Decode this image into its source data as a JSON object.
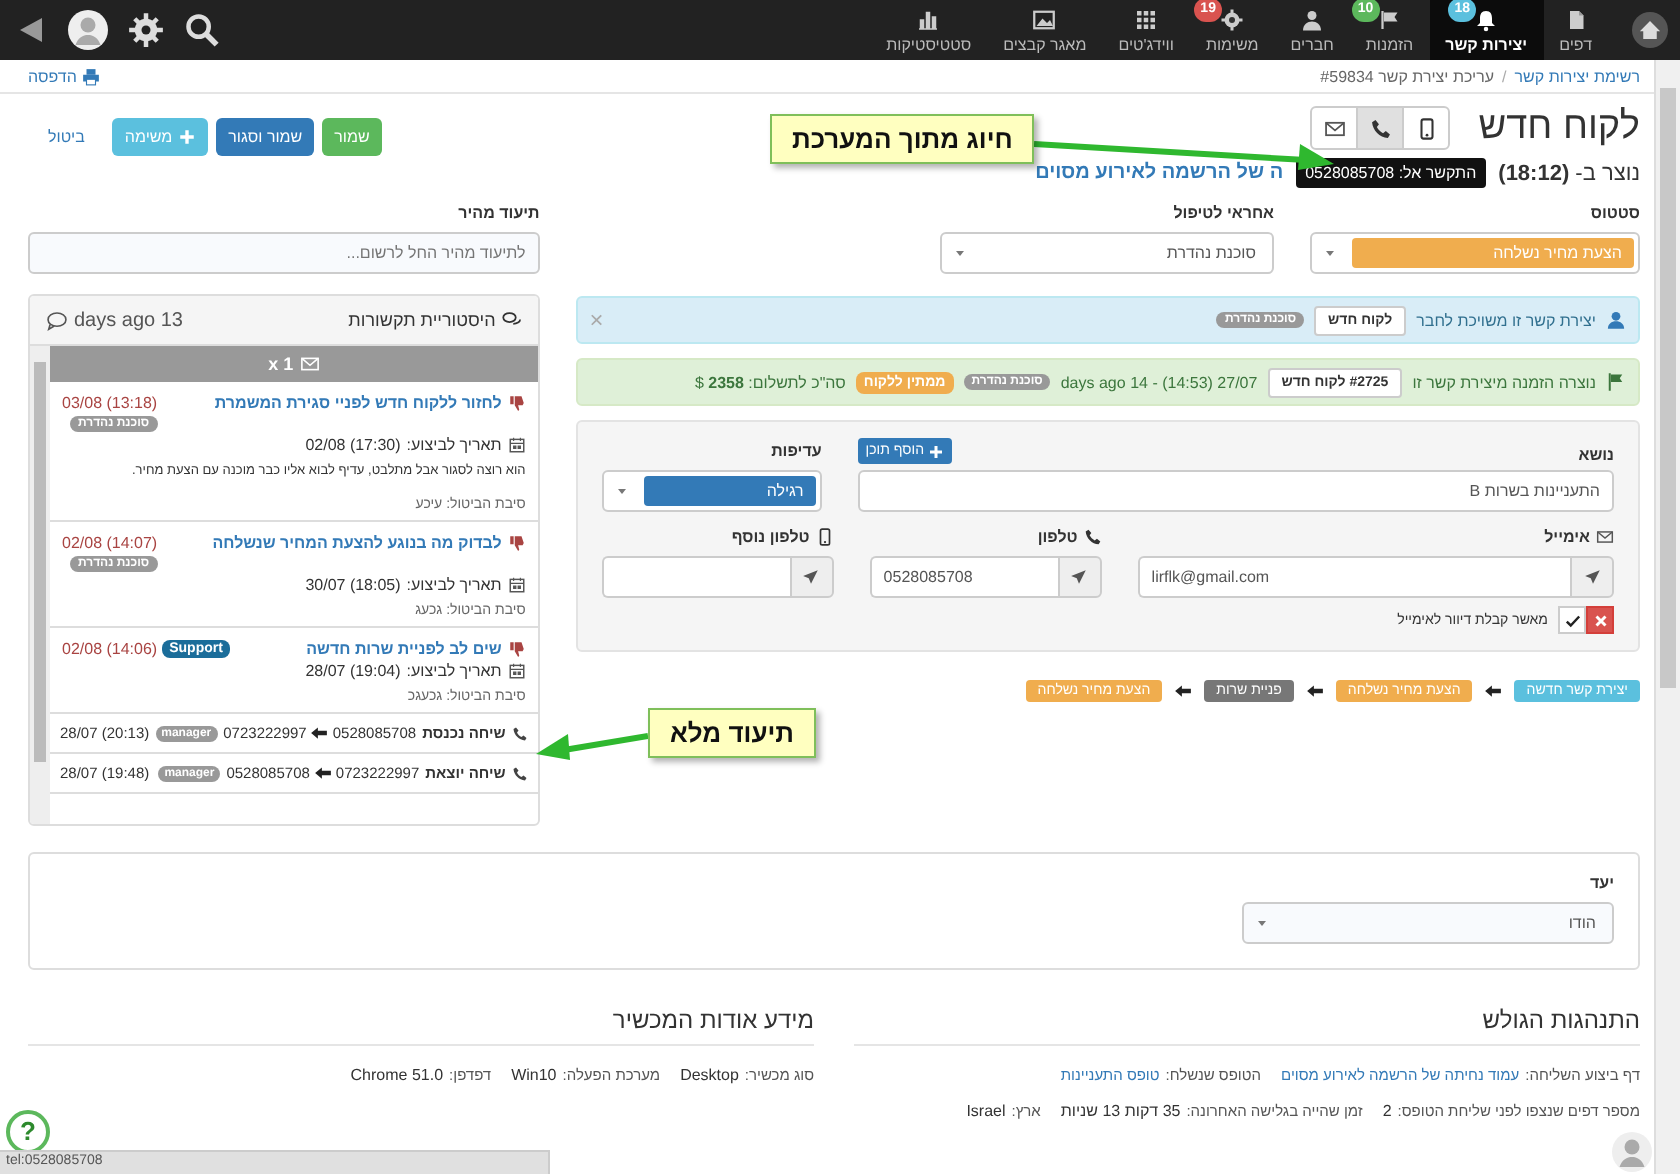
{
  "nav": {
    "items": [
      {
        "label": "דפים",
        "selected": false
      },
      {
        "label": "יצירות קשר",
        "badge": "18",
        "kind": "info",
        "selected": true
      },
      {
        "label": "הזמנות",
        "badge": "10",
        "kind": "success",
        "selected": false
      },
      {
        "label": "חברים",
        "selected": false
      },
      {
        "label": "משימות",
        "badge": "19",
        "kind": "danger",
        "selected": false
      },
      {
        "label": "ווידג'טים",
        "selected": false
      },
      {
        "label": "מאגר קבצים",
        "selected": false
      },
      {
        "label": "סטטיסטיקות",
        "selected": false
      }
    ]
  },
  "breadcrumb": {
    "items": [
      "רשימת יצירות קשר",
      "עריכת יצירת קשר #59834"
    ],
    "separator": "/",
    "print": "הדפסה"
  },
  "header": {
    "title": "לקוח חדש",
    "contact_buttons": [
      {
        "selected": false
      },
      {
        "selected": true
      },
      {
        "selected": false
      }
    ],
    "actions": [
      {
        "label": "שמור",
        "kind": "success"
      },
      {
        "label": "שמור וסגור",
        "kind": "primary"
      },
      {
        "label": "משימה",
        "kind": "info"
      },
      {
        "label": "ביטול",
        "kind": "link"
      }
    ],
    "created": "נוצר ב- **(18:12)**",
    "source_link": "ה של הרשמה לאירוע מסוים",
    "tooltip": "התקשר אל: 0528085708"
  },
  "fields": {
    "status": {
      "label": "סטטוס",
      "value": "הצעת מחיר נשלחה",
      "kind": "warning"
    },
    "handler": {
      "label": "אחראי לטיפול",
      "value": "סוכנת נהדרת"
    },
    "quick_note": {
      "label": "תיעוד מהיר",
      "placeholder": "לתיעוד מהיר החל לרשום..."
    }
  },
  "member_alert": {
    "text": "יצירת קשר זו משויכת לחבר",
    "button": "לקוח חדש",
    "tag": "סוכנת נהדרת",
    "close": "×"
  },
  "order_alert": {
    "text": "נוצרה הזמנה מיצירת קשר זו",
    "button": "#2725 לקוח חדש",
    "date": "27/07 (14:53) - 14 days ago",
    "tag": "סוכנת נהדרת",
    "status": "ממתין ללקוח",
    "total": "סה\"כ לתשלום: **2358** $"
  },
  "form": {
    "subject": {
      "label": "נושא",
      "add_button": "הוסף תוכן",
      "value": "התעניינות בשרות B"
    },
    "priority": {
      "label": "עדיפות",
      "value": "רגילה",
      "kind": "primary"
    },
    "email": {
      "label": "אימייל",
      "value": "lirflk@gmail.com"
    },
    "phone": {
      "label": "טלפון",
      "value": "0528085708"
    },
    "extra_phone": {
      "label": "טלפון נוסף"
    },
    "newsletter": {
      "label": "מאשר קבלת דיוור לאימייל",
      "approved": false
    }
  },
  "pipeline": [
    {
      "label": "יצירת קשר חדשה",
      "kind": "info"
    },
    {
      "label": "הצעת מחיר נשלחה",
      "kind": "warning"
    },
    {
      "label": "פניית שרות",
      "kind": "default"
    },
    {
      "label": "הצעת מחיר נשלחה",
      "kind": "warning"
    }
  ],
  "history": {
    "title": "היסטוריית תקשורות",
    "last": "13 days ago",
    "group": "x 1",
    "entries": [
      {
        "kind": "task",
        "title": "לחזור ללקוח חדש לפניי סגירת המשמרת",
        "time": "03/08 (13:18)",
        "tag": {
          "text": "סוכנת נהדרת",
          "kind": "default"
        },
        "due_label": "תאריך לביצוע:",
        "due": "02/08 (17:30)",
        "note": "הוא רוצה לסגור אבל מתלבט, עדיף לבוא אליו כבר מוכנה עם הצעת מחיר.",
        "reason": "סיבת הביטול: עיכע"
      },
      {
        "kind": "task",
        "title": "לבדוק מה בנוגע להצעת המחיר שנשלחה",
        "time": "02/08 (14:07)",
        "tag": {
          "text": "סוכנת נהדרת",
          "kind": "default"
        },
        "due_label": "תאריך לביצוע:",
        "due": "30/07 (18:05)",
        "reason": "סיבת הביטול: גכעג"
      },
      {
        "kind": "task",
        "title": "שים לב לפניית שרות חדשה",
        "time": "02/08 (14:06)",
        "tag": {
          "text": "Support",
          "kind": "primary"
        },
        "due_label": "תאריך לביצוע:",
        "due": "28/07 (19:04)",
        "reason": "סיבת הביטול: גכעגכ"
      },
      {
        "kind": "call",
        "title": "שיחה נכנסת",
        "from": "0528085708",
        "to": "0723222997",
        "tag": {
          "text": "manager",
          "kind": "default"
        },
        "time": "28/07 (20:13)"
      },
      {
        "kind": "call",
        "title": "שיחה יוצאת",
        "from": "0723222997",
        "to": "0528085708",
        "tag": {
          "text": "manager",
          "kind": "default"
        },
        "time": "28/07 (19:48)"
      }
    ]
  },
  "target": {
    "label": "יעד",
    "value": "הודו"
  },
  "browsing": {
    "title": "התנהגות הגולש",
    "lines": [
      [
        {
          "label": "דף ביצוע השליחה:",
          "value": "עמוד נחיתה של הרשמה לאירוע מסוים",
          "kind": "link"
        },
        {
          "label": "הטופס שנשלח:",
          "value": "טופס התעניינות",
          "kind": "link"
        }
      ],
      [
        {
          "label": "מספר דפים שנצפו לפני שליחת הטופס:",
          "value": "2",
          "kind": "text"
        },
        {
          "label": "זמן שהייה בגלישה האחרונה:",
          "value": "35 דקות 13 שניות",
          "kind": "text"
        },
        {
          "label": "ארץ:",
          "value": "Israel",
          "kind": "text"
        }
      ]
    ]
  },
  "device": {
    "title": "מידע אודות המכשיר",
    "lines": [
      [
        {
          "label": "סוג מכשיר:",
          "value": "Desktop",
          "kind": "text"
        },
        {
          "label": "מערכת הפעלה:",
          "value": "Win10",
          "kind": "text"
        },
        {
          "label": "דפדפן:",
          "value": "Chrome 51.0",
          "kind": "text"
        }
      ]
    ]
  },
  "annotations": [
    {
      "text": "חיוג מתוך המערכת",
      "kind": "dial"
    },
    {
      "text": "תיעוד מלא",
      "kind": "history"
    }
  ],
  "help": "?",
  "status_bar": "tel:0528085708"
}
